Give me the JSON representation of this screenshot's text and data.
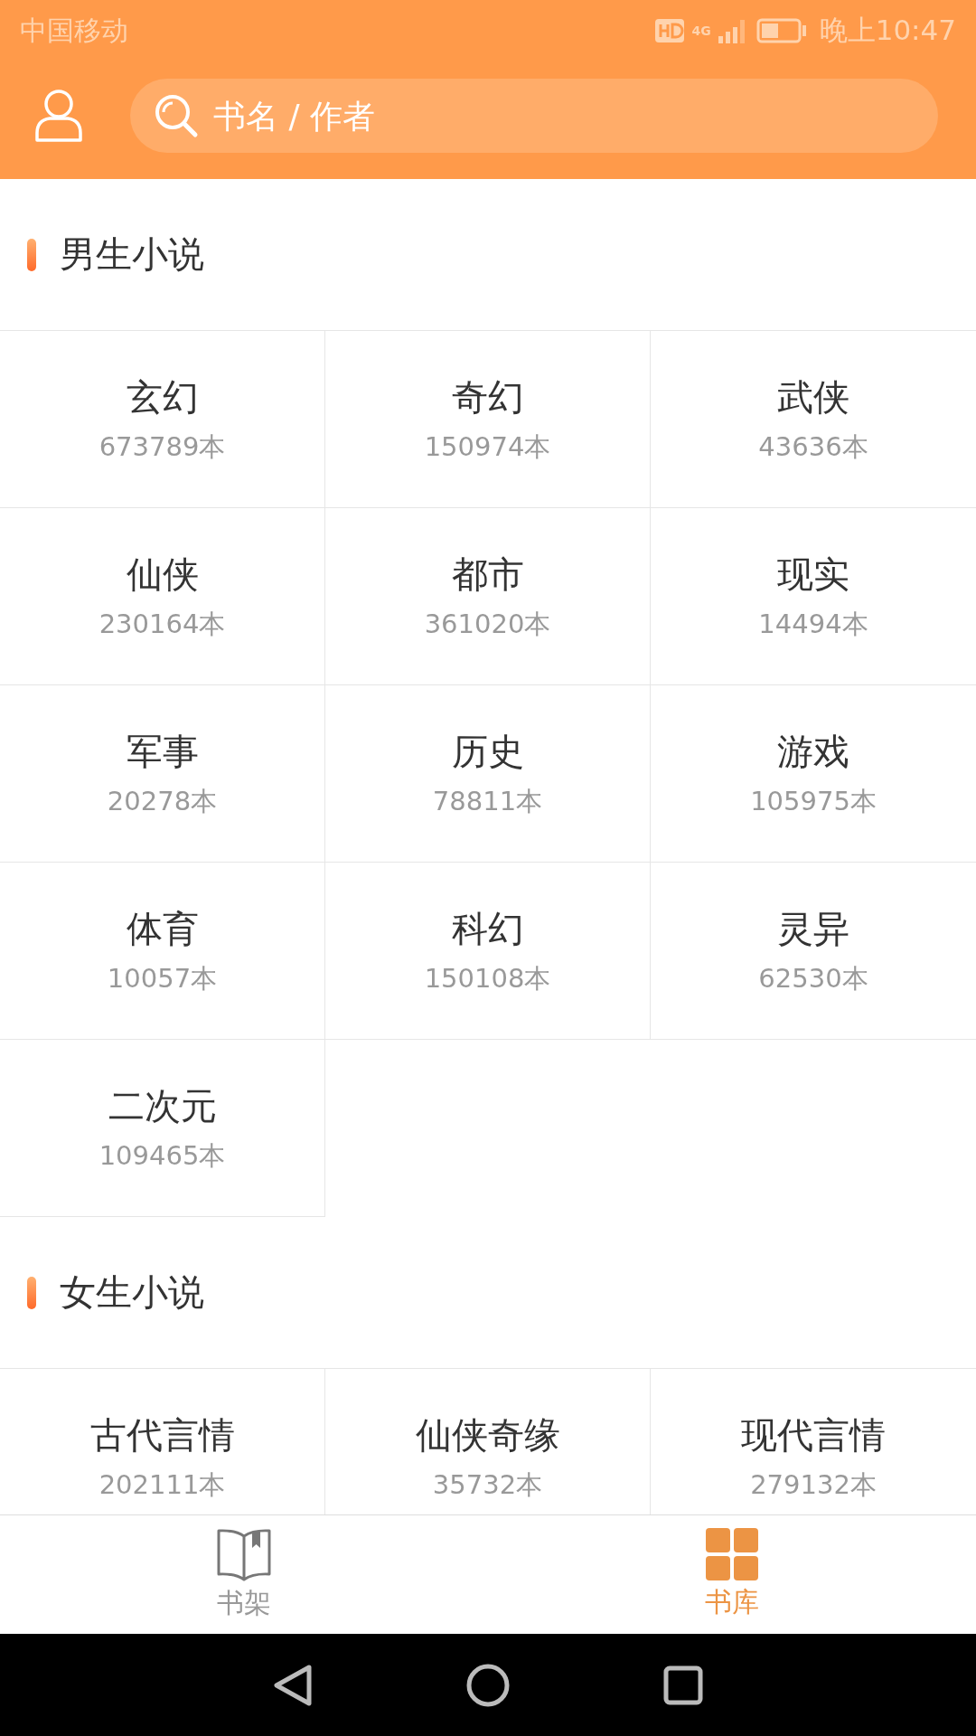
{
  "status_bar": {
    "carrier": "中国移动",
    "time": "晚上10:47",
    "network": "4G"
  },
  "header": {
    "search": {
      "placeholder": "书名 / 作者"
    }
  },
  "sections": [
    {
      "title": "男生小说",
      "categories": [
        {
          "name": "玄幻",
          "count": "673789本"
        },
        {
          "name": "奇幻",
          "count": "150974本"
        },
        {
          "name": "武侠",
          "count": "43636本"
        },
        {
          "name": "仙侠",
          "count": "230164本"
        },
        {
          "name": "都市",
          "count": "361020本"
        },
        {
          "name": "现实",
          "count": "14494本"
        },
        {
          "name": "军事",
          "count": "20278本"
        },
        {
          "name": "历史",
          "count": "78811本"
        },
        {
          "name": "游戏",
          "count": "105975本"
        },
        {
          "name": "体育",
          "count": "10057本"
        },
        {
          "name": "科幻",
          "count": "150108本"
        },
        {
          "name": "灵异",
          "count": "62530本"
        },
        {
          "name": "二次元",
          "count": "109465本"
        }
      ]
    },
    {
      "title": "女生小说",
      "categories": [
        {
          "name": "古代言情",
          "count": "202111本"
        },
        {
          "name": "仙侠奇缘",
          "count": "35732本"
        },
        {
          "name": "现代言情",
          "count": "279132本"
        }
      ]
    }
  ],
  "tab_bar": [
    {
      "kind": "shelf",
      "label": "书架",
      "selected": false
    },
    {
      "kind": "library",
      "label": "书库",
      "selected": true
    }
  ]
}
